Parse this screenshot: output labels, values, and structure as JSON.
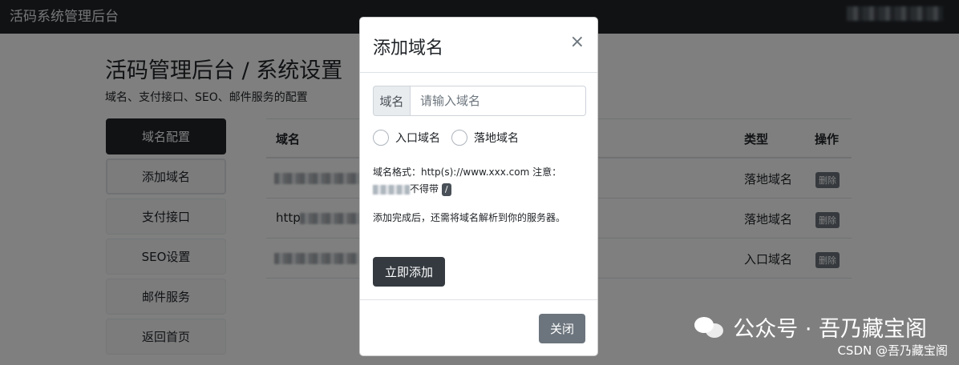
{
  "navbar": {
    "brand": "活码系统管理后台"
  },
  "page": {
    "title": "活码管理后台 / 系统设置",
    "subtitle": "域名、支付接口、SEO、邮件服务的配置"
  },
  "sidebar": {
    "items": [
      {
        "label": "域名配置"
      },
      {
        "label": "添加域名"
      },
      {
        "label": "支付接口"
      },
      {
        "label": "SEO设置"
      },
      {
        "label": "邮件服务"
      },
      {
        "label": "返回首页"
      }
    ]
  },
  "table": {
    "headers": {
      "domain": "域名",
      "type": "类型",
      "action": "操作"
    },
    "rows": [
      {
        "domain": "",
        "type": "落地域名",
        "action": "删除"
      },
      {
        "domain": "http",
        "type": "落地域名",
        "action": "删除"
      },
      {
        "domain": "",
        "type": "入口域名",
        "action": "删除"
      }
    ]
  },
  "modal": {
    "title": "添加域名",
    "close_icon": "×",
    "input_label": "域名",
    "input_placeholder": "请输入域名",
    "radio_entry": "入口域名",
    "radio_landing": "落地域名",
    "hint_format": "域名格式：http(s)://www.xxx.com 注意：",
    "hint_not_with": "不得带",
    "hint_slash": "/",
    "hint_resolve": "添加完成后，还需将域名解析到你的服务器。",
    "submit_label": "立即添加",
    "footer_close_label": "关闭"
  },
  "watermark": {
    "text": "公众号 · 吾乃藏宝阁",
    "csdn": "CSDN @吾乃藏宝阁"
  }
}
